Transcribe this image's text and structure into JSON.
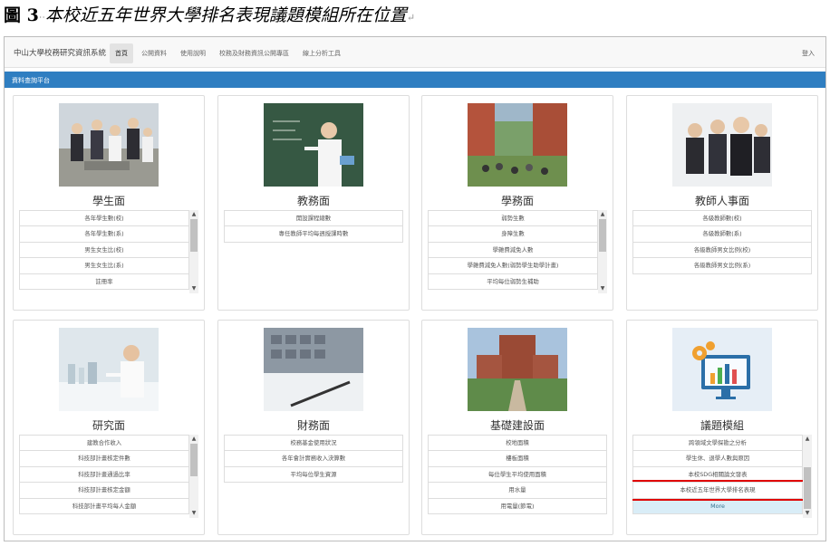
{
  "caption": {
    "figure": "圖 3",
    "marks": "‧‧",
    "text": "本校近五年世界大學排名表現議題模組所在位置",
    "end_mark": "↵"
  },
  "navbar": {
    "brand": "中山大學校務研究資訊系統",
    "links": [
      "首頁",
      "公開資料",
      "使用說明",
      "校務及財務資訊公開專區",
      "線上分析工具"
    ],
    "login": "登入"
  },
  "subbar": {
    "title": "資料查詢平台"
  },
  "cards": [
    {
      "title": "學生面",
      "items": [
        "各年學生數(校)",
        "各年學生數(系)",
        "男生女生比(校)",
        "男生女生比(系)",
        "註冊率"
      ]
    },
    {
      "title": "教務面",
      "items": [
        "開設課程總數",
        "專任教師平均每週授課時數"
      ]
    },
    {
      "title": "學務面",
      "items": [
        "弱勢生數",
        "身障生數",
        "學雜費減免人數",
        "學雜費減免人數(弱勢學生助學計畫)",
        "平均每位弱勢生補助"
      ]
    },
    {
      "title": "教師人事面",
      "items": [
        "各級教師數(校)",
        "各級教師數(系)",
        "各級教師男女比例(校)",
        "各級教師男女比例(系)"
      ]
    },
    {
      "title": "研究面",
      "items": [
        "建教合作收入",
        "科技部計畫核定件數",
        "科技部計畫通過比率",
        "科技部計畫核定金額",
        "科技部計畫平均每人金額"
      ]
    },
    {
      "title": "財務面",
      "items": [
        "校務基金使用狀況",
        "各年會計實務收入決算數",
        "平均每位學生資源"
      ]
    },
    {
      "title": "基礎建設面",
      "items": [
        "校地面積",
        "樓板面積",
        "每位學生平均使用面積",
        "用水量",
        "用電量(節電)"
      ]
    },
    {
      "title": "議題模組",
      "items": [
        "跨領域文學探勘之分析",
        "學生休、退學人數與原因",
        "本校SDG相關論文發表",
        "本校近五年世界大學排名表現",
        "More"
      ]
    }
  ],
  "colors": {
    "accent": "#2f7ec1",
    "highlight": "#e00000",
    "more_bg": "#d9edf7"
  }
}
